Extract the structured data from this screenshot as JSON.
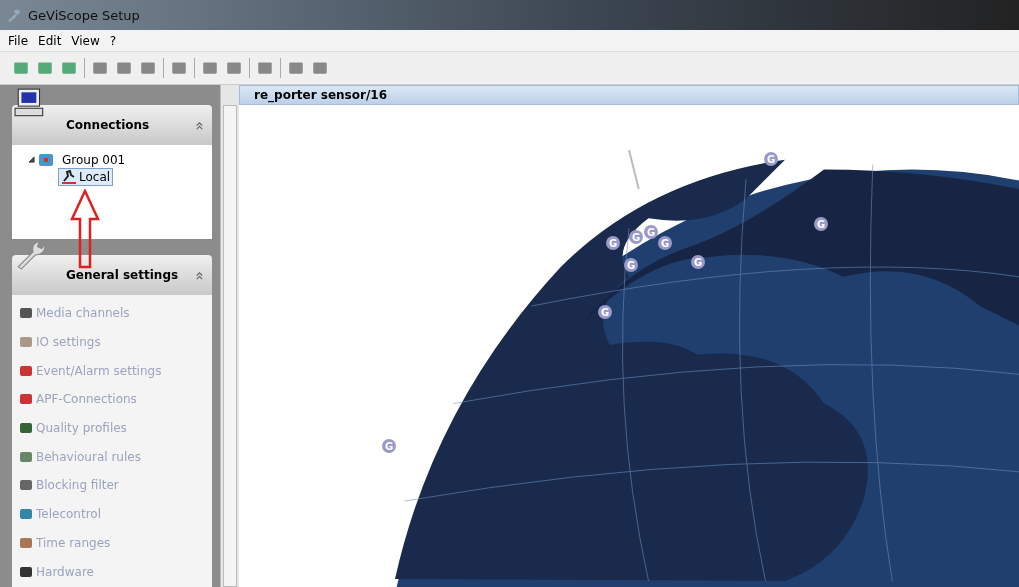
{
  "window": {
    "title": "GeViScope Setup"
  },
  "menu": [
    "File",
    "Edit",
    "View",
    "?"
  ],
  "sections": [
    {
      "title": "Connections",
      "kind": "tree",
      "expanded": true,
      "tree": [
        {
          "label": "Group 001",
          "expanded": true,
          "selected": false,
          "children": [
            {
              "label": "Local",
              "selected": true
            }
          ]
        }
      ]
    },
    {
      "title": "General settings",
      "kind": "list",
      "expanded": true,
      "items": [
        {
          "label": "Media channels",
          "disabled": true
        },
        {
          "label": "IO settings",
          "disabled": true
        },
        {
          "label": "Event/Alarm settings",
          "disabled": true
        },
        {
          "label": "APF-Connections",
          "disabled": true
        },
        {
          "label": "Quality profiles",
          "disabled": true
        },
        {
          "label": "Behavioural rules",
          "disabled": true
        },
        {
          "label": "Blocking filter",
          "disabled": true
        },
        {
          "label": "Telecontrol",
          "disabled": true
        },
        {
          "label": "Time ranges",
          "disabled": true
        },
        {
          "label": "Hardware",
          "disabled": true
        }
      ]
    }
  ],
  "document": {
    "title": "re_porter sensor/16",
    "pins": [
      "G",
      "G",
      "G",
      "G",
      "G",
      "G",
      "G",
      "G",
      "G",
      "G"
    ]
  }
}
